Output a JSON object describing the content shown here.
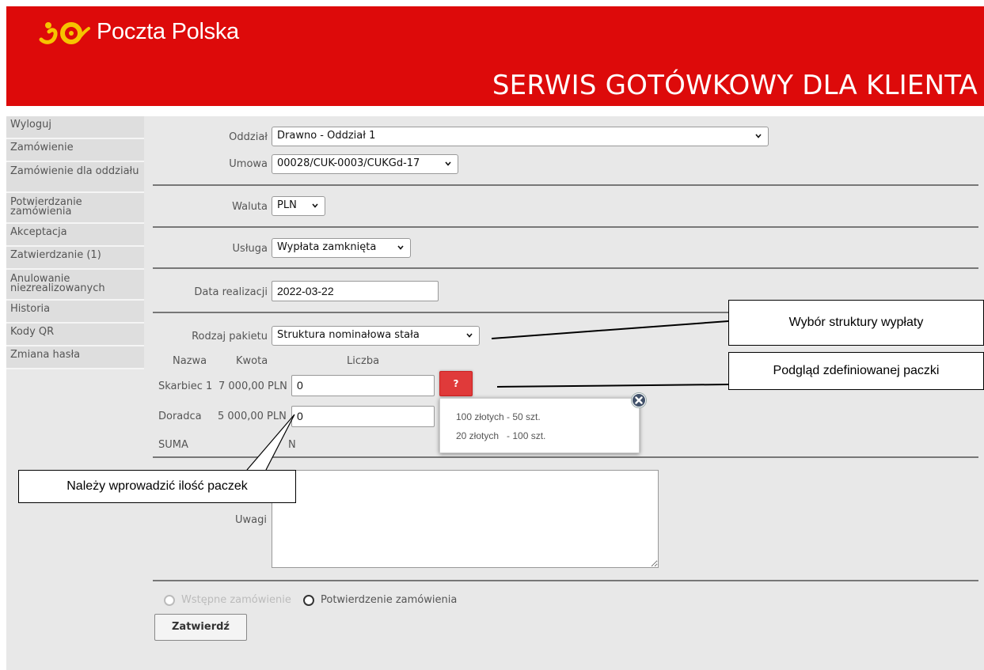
{
  "header": {
    "brand": "Poczta Polska",
    "title": "SERWIS GOTÓWKOWY DLA KLIENTA",
    "color": "#dd0a0a"
  },
  "sidebar": {
    "items": [
      {
        "label": "Wyloguj"
      },
      {
        "label": "Zamówienie"
      },
      {
        "label": "Zamówienie dla oddziału"
      },
      {
        "label": "Potwierdzanie zamówienia"
      },
      {
        "label": "Akceptacja"
      },
      {
        "label": "Zatwierdzanie (1)"
      },
      {
        "label": "Anulowanie niezrealizowanych"
      },
      {
        "label": "Historia"
      },
      {
        "label": "Kody QR"
      },
      {
        "label": "Zmiana hasła"
      }
    ]
  },
  "form": {
    "oddzial": {
      "label": "Oddział",
      "value": "Drawno - Oddział 1"
    },
    "umowa": {
      "label": "Umowa",
      "value": "00028/CUK-0003/CUKGd-17"
    },
    "waluta": {
      "label": "Waluta",
      "value": "PLN"
    },
    "usluga": {
      "label": "Usługa",
      "value": "Wypłata zamknięta"
    },
    "data_realizacji": {
      "label": "Data realizacji",
      "value": "2022-03-22"
    },
    "rodzaj_pakietu": {
      "label": "Rodzaj pakietu",
      "value": "Struktura nominałowa stała"
    },
    "columns": {
      "nazwa": "Nazwa",
      "kwota": "Kwota",
      "liczba": "Liczba"
    },
    "rows": [
      {
        "nazwa": "Skarbiec 1",
        "kwota": "7 000,00 PLN",
        "liczba": "0"
      },
      {
        "nazwa": "Doradca",
        "kwota": "5 000,00 PLN",
        "liczba": "0"
      }
    ],
    "suma_label": "SUMA",
    "suma_value_fragment": "N",
    "preview_button": "?",
    "preview_popup": {
      "lines": [
        "100 złotych - 50 szt.",
        "20 złotych   - 100 szt."
      ]
    },
    "uwagi": {
      "label": "Uwagi",
      "value": ""
    },
    "radio_wstepne": "Wstępne zamówienie",
    "radio_potwierdzenie": "Potwierdzenie zamówienia",
    "submit_label": "Zatwierdź"
  },
  "callouts": {
    "struktura": "Wybór struktury wypłaty",
    "podglad": "Podgląd zdefiniowanej paczki",
    "ilosc": "Należy wprowadzić ilość paczek"
  }
}
